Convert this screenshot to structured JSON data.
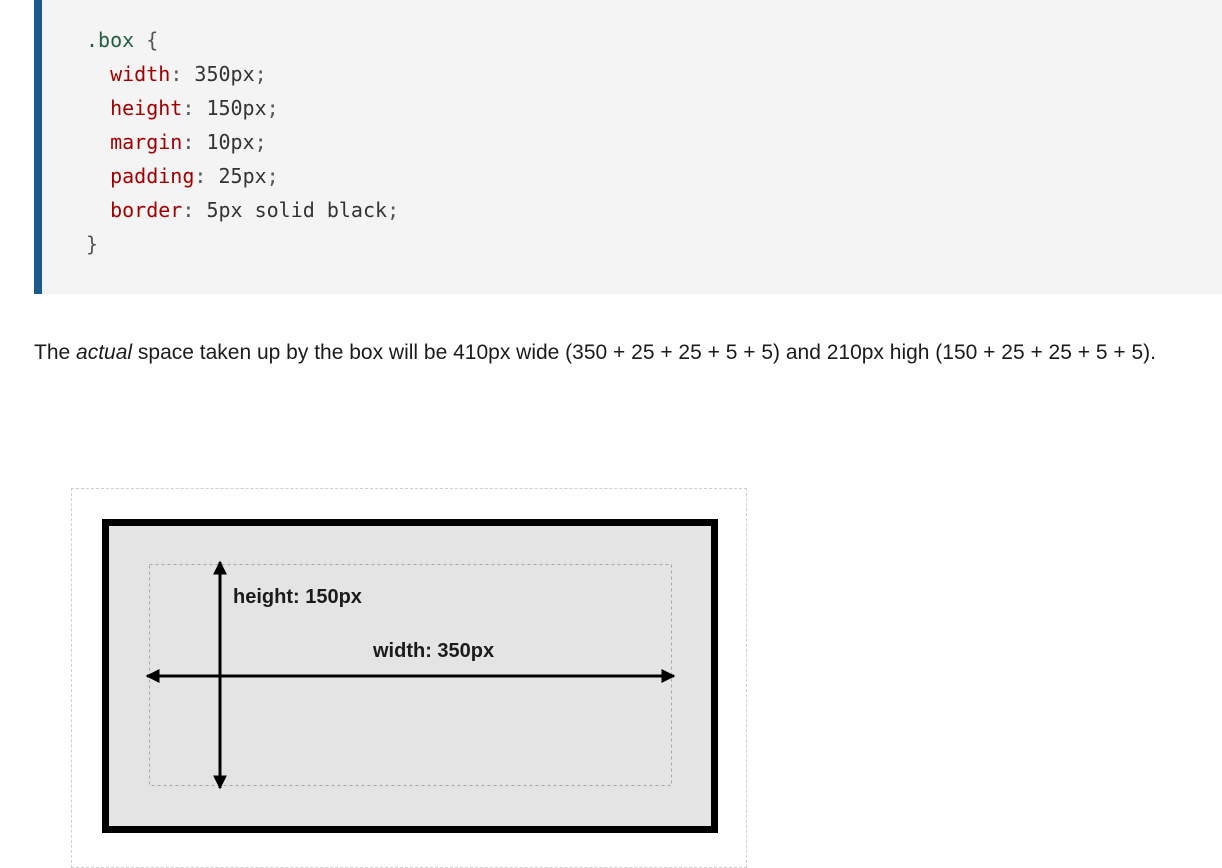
{
  "code": {
    "selector": ".box",
    "open_brace": "{",
    "close_brace": "}",
    "declarations": [
      {
        "property": "width",
        "value": "350px"
      },
      {
        "property": "height",
        "value": "150px"
      },
      {
        "property": "margin",
        "value": "10px"
      },
      {
        "property": "padding",
        "value": "25px"
      },
      {
        "property": "border",
        "value": "5px solid black"
      }
    ]
  },
  "paragraph": {
    "before": "The ",
    "emphasis": "actual",
    "after": " space taken up by the box will be 410px wide (350 + 25 + 25 + 5 + 5) and 210px high (150 + 25 + 25 + 5 + 5)."
  },
  "diagram": {
    "height_label": "height: 150px",
    "width_label": "width: 350px"
  },
  "colors": {
    "code_accent": "#1b5a8a",
    "property": "#a00000",
    "selector": "#1f5e3f",
    "box_fill": "#e4e4e4",
    "border": "#000000"
  }
}
